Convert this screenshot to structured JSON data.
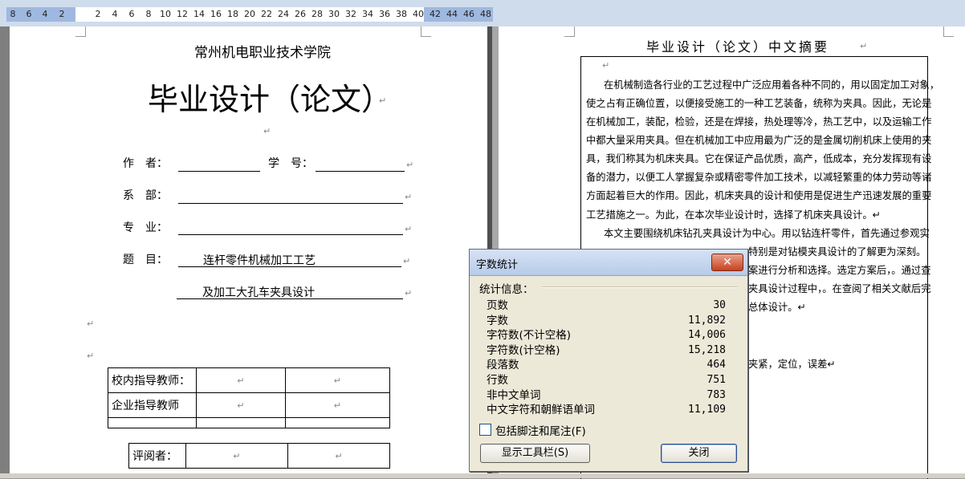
{
  "ruler": {
    "ticks": [
      "8",
      "6",
      "4",
      "2",
      "2",
      "4",
      "6",
      "8",
      "10",
      "12",
      "14",
      "16",
      "18",
      "20",
      "22",
      "24",
      "26",
      "28",
      "30",
      "32",
      "34",
      "36",
      "38",
      "40",
      "42",
      "44",
      "46",
      "48"
    ]
  },
  "page1": {
    "school": "常州机电职业技术学院",
    "title": "毕业设计（论文）",
    "author_label": "作　者：",
    "student_no_label": "学　号：",
    "dept_label": "系　部：",
    "major_label": "专　业：",
    "topic_label": "题　目：",
    "topic_line1": "连杆零件机械加工工艺",
    "topic_line2": "及加工大孔车夹具设计",
    "inner_advisor": "校内指导教师：",
    "company_advisor": "企业指导教师",
    "reviewer": "评阅者：",
    "para_mark": "↵"
  },
  "page2": {
    "heading": "毕业设计（论文）中文摘要",
    "lines": [
      "在机械制造各行业的工艺过程中广泛应用着各种不同的，用以固定加工对象，",
      "使之占有正确位置，以便接受施工的一种工艺装备，统称为夹具。因此，无论是",
      "在机械加工，装配，检验，还是在焊接，热处理等冷，热工艺中，以及运输工作",
      "中都大量采用夹具。但在机械加工中应用最为广泛的是金属切削机床上使用的夹",
      "具，我们称其为机床夹具。它在保证产品优质，高产，低成本，充分发挥现有设",
      "备的潜力，以便工人掌握复杂或精密零件加工技术，以减轻繁重的体力劳动等诸",
      "方面起着巨大的作用。因此，机床夹具的设计和使用是促进生产迅速发展的重要",
      "工艺措施之一。为此，在本次毕业设计时，选择了机床夹具设计。↵",
      "本文主要围绕机床钻孔夹具设计为中心。用以钻连杆零件，首先通过参观实",
      "特别是对钻模夹具设计的了解更为深刻。",
      "案进行分析和选择。选定方案后，。通过查",
      "夹具设计过程中，。在查阅了相关文献后完",
      "总体设计。↵",
      "夹紧，定位，误差↵"
    ]
  },
  "dialog": {
    "title": "字数统计",
    "close_x": "✕",
    "section": "统计信息：",
    "stats": [
      {
        "label": "页数",
        "value": "30"
      },
      {
        "label": "字数",
        "value": "11,892"
      },
      {
        "label": "字符数(不计空格)",
        "value": "14,006"
      },
      {
        "label": "字符数(计空格)",
        "value": "15,218"
      },
      {
        "label": "段落数",
        "value": "464"
      },
      {
        "label": "行数",
        "value": "751"
      },
      {
        "label": "非中文单词",
        "value": "783"
      },
      {
        "label": "中文字符和朝鲜语单词",
        "value": "11,109"
      }
    ],
    "checkbox_label": "包括脚注和尾注(F)",
    "checkbox_checked": false,
    "toolbar_button": "显示工具栏(S)",
    "close_button": "关闭"
  }
}
